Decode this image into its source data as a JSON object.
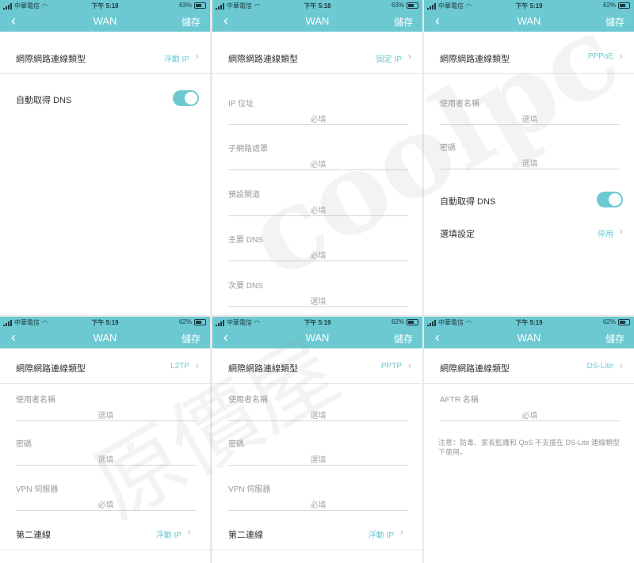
{
  "accent_color": "#6cc9d2",
  "screens": [
    {
      "status": {
        "carrier": "中華電信",
        "time": "下午 5:18",
        "battery": "63%"
      },
      "nav": {
        "title": "WAN",
        "save": "儲存"
      },
      "conn": {
        "label": "網際網路連線類型",
        "value": "浮動 IP"
      },
      "dns": {
        "label": "自動取得 DNS"
      }
    },
    {
      "status": {
        "carrier": "中華電信",
        "time": "下午 5:18",
        "battery": "63%"
      },
      "nav": {
        "title": "WAN",
        "save": "儲存"
      },
      "conn": {
        "label": "網際網路連線類型",
        "value": "固定 IP"
      },
      "fields": [
        {
          "label": "IP 位址",
          "placeholder": "必填"
        },
        {
          "label": "子網路遮罩",
          "placeholder": "必填"
        },
        {
          "label": "預設閘道",
          "placeholder": "必填"
        },
        {
          "label": "主要 DNS",
          "placeholder": "必填"
        },
        {
          "label": "次要 DNS",
          "placeholder": "選填"
        }
      ]
    },
    {
      "status": {
        "carrier": "中華電信",
        "time": "下午 5:19",
        "battery": "62%"
      },
      "nav": {
        "title": "WAN",
        "save": "儲存"
      },
      "conn": {
        "label": "網際網路連線類型",
        "value": "PPPoE"
      },
      "fields": [
        {
          "label": "使用者名稱",
          "placeholder": "選填"
        },
        {
          "label": "密碼",
          "placeholder": "選填"
        }
      ],
      "dns": {
        "label": "自動取得 DNS"
      },
      "optional": {
        "label": "選填設定",
        "value": "停用"
      }
    },
    {
      "status": {
        "carrier": "中華電信",
        "time": "下午 5:19",
        "battery": "62%"
      },
      "nav": {
        "title": "WAN",
        "save": "儲存"
      },
      "conn": {
        "label": "網際網路連線類型",
        "value": "L2TP"
      },
      "fields": [
        {
          "label": "使用者名稱",
          "placeholder": "選填"
        },
        {
          "label": "密碼",
          "placeholder": "選填"
        },
        {
          "label": "VPN 伺服器",
          "placeholder": "必填"
        }
      ],
      "second": {
        "label": "第二連線",
        "value": "浮動 IP"
      }
    },
    {
      "status": {
        "carrier": "中華電信",
        "time": "下午 5:19",
        "battery": "62%"
      },
      "nav": {
        "title": "WAN",
        "save": "儲存"
      },
      "conn": {
        "label": "網際網路連線類型",
        "value": "PPTP"
      },
      "fields": [
        {
          "label": "使用者名稱",
          "placeholder": "選填"
        },
        {
          "label": "密碼",
          "placeholder": "選填"
        },
        {
          "label": "VPN 伺服器",
          "placeholder": "必填"
        }
      ],
      "second": {
        "label": "第二連線",
        "value": "浮動 IP"
      }
    },
    {
      "status": {
        "carrier": "中華電信",
        "time": "下午 5:19",
        "battery": "62%"
      },
      "nav": {
        "title": "WAN",
        "save": "儲存"
      },
      "conn": {
        "label": "網際網路連線類型",
        "value": "DS-Lite"
      },
      "fields": [
        {
          "label": "AFTR 名稱",
          "placeholder": "必填"
        }
      ],
      "note": "注意：防毒、家長監護和 QoS 不支援在 DS-Lite 連線類型下使用。"
    }
  ],
  "watermark": {
    "text": "原價屋coolpc"
  }
}
